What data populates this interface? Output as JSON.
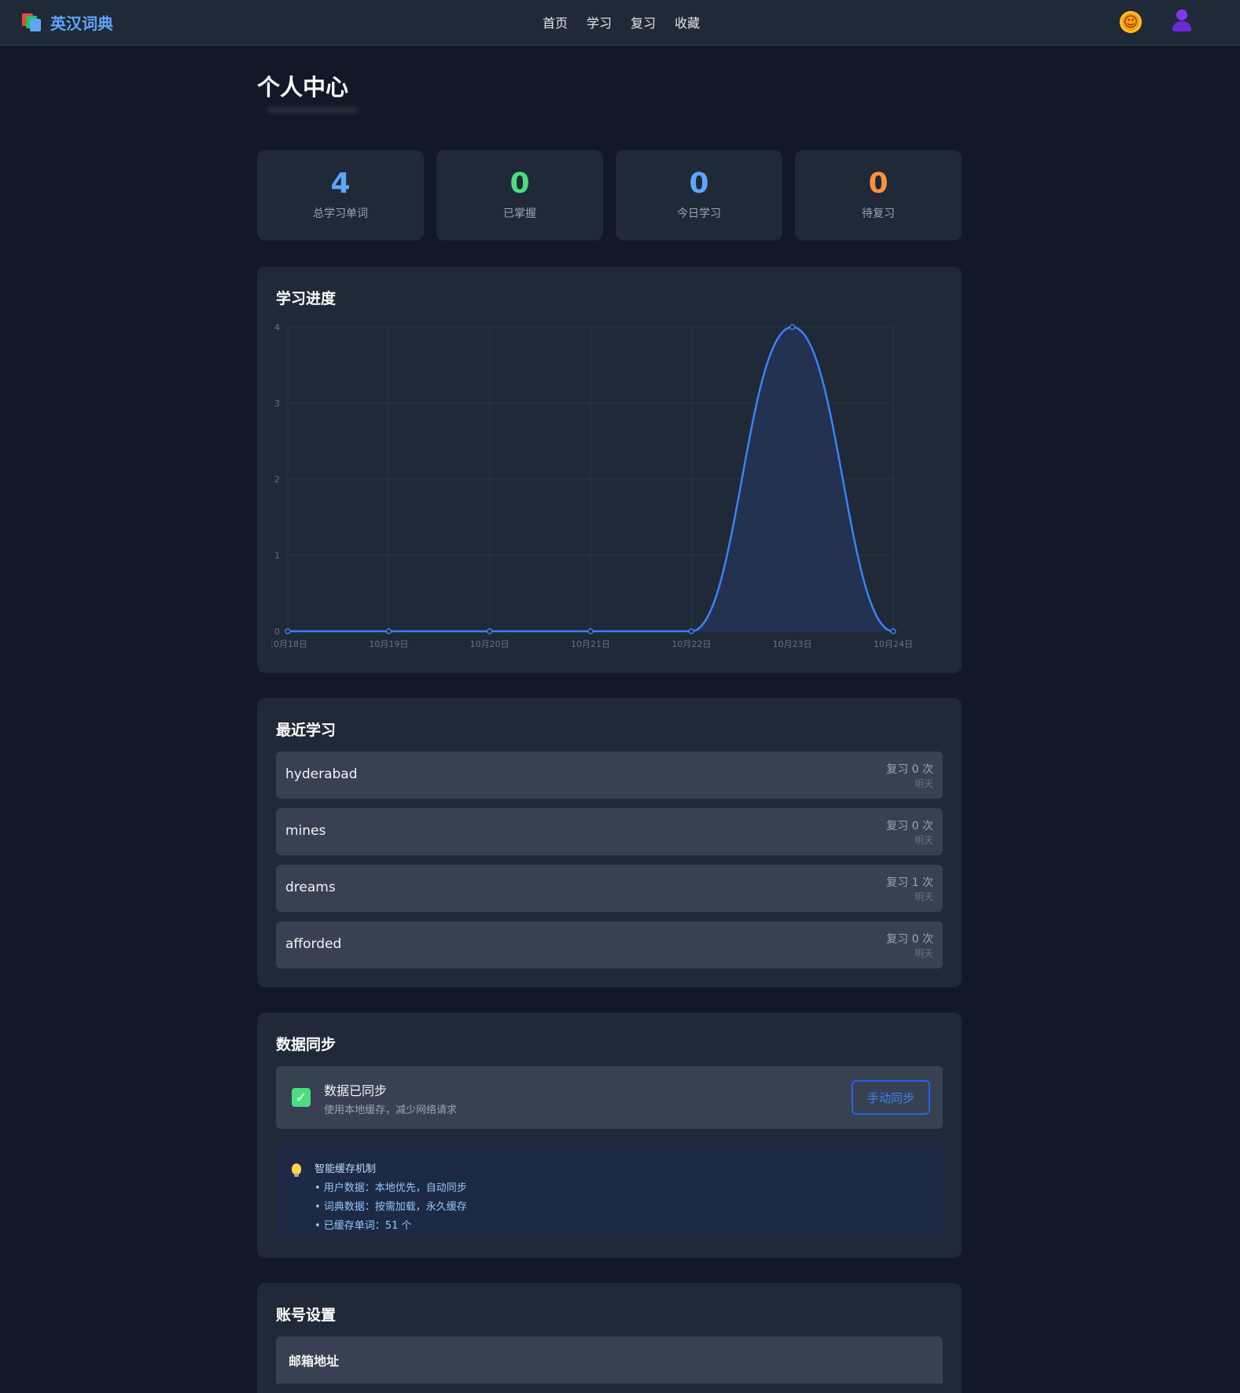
{
  "nav": {
    "brand": "英汉词典",
    "items": [
      "首页",
      "学习",
      "复习",
      "收藏"
    ],
    "theme_icon": "sun-icon",
    "avatar_icon": "user-icon"
  },
  "page": {
    "title": "个人中心"
  },
  "stats": [
    {
      "value": "4",
      "label": "总学习单词",
      "color": "#60a5fa"
    },
    {
      "value": "0",
      "label": "已掌握",
      "color": "#4ade80"
    },
    {
      "value": "0",
      "label": "今日学习",
      "color": "#60a5fa"
    },
    {
      "value": "0",
      "label": "待复习",
      "color": "#fb923c"
    }
  ],
  "progress": {
    "title": "学习进度",
    "chart_data": {
      "type": "area",
      "x": [
        "10月18日",
        "10月19日",
        "10月20日",
        "10月21日",
        "10月22日",
        "10月23日",
        "10月24日"
      ],
      "values": [
        0,
        0,
        0,
        0,
        0,
        4,
        0
      ],
      "y_ticks": [
        "0",
        "1",
        "2",
        "3",
        "4"
      ],
      "ylim": [
        0,
        4
      ],
      "grid": true,
      "line_color": "#3b82f6",
      "fill_color": "#233251"
    }
  },
  "recent": {
    "title": "最近学习",
    "items": [
      {
        "word": "hyderabad",
        "count": "复习 0 次",
        "when": "明天"
      },
      {
        "word": "mines",
        "count": "复习 0 次",
        "when": "明天"
      },
      {
        "word": "dreams",
        "count": "复习 1 次",
        "when": "明天"
      },
      {
        "word": "afforded",
        "count": "复习 0 次",
        "when": "明天"
      }
    ]
  },
  "sync": {
    "title": "数据同步",
    "status": "数据已同步",
    "sub": "使用本地缓存，减少网络请求",
    "button": "手动同步",
    "cache_title": "智能缓存机制",
    "cache_lines": [
      "• 用户数据：本地优先，自动同步",
      "• 词典数据：按需加载，永久缓存",
      "• 已缓存单词：51 个"
    ]
  },
  "account": {
    "title": "账号设置",
    "email_label": "邮箱地址"
  }
}
